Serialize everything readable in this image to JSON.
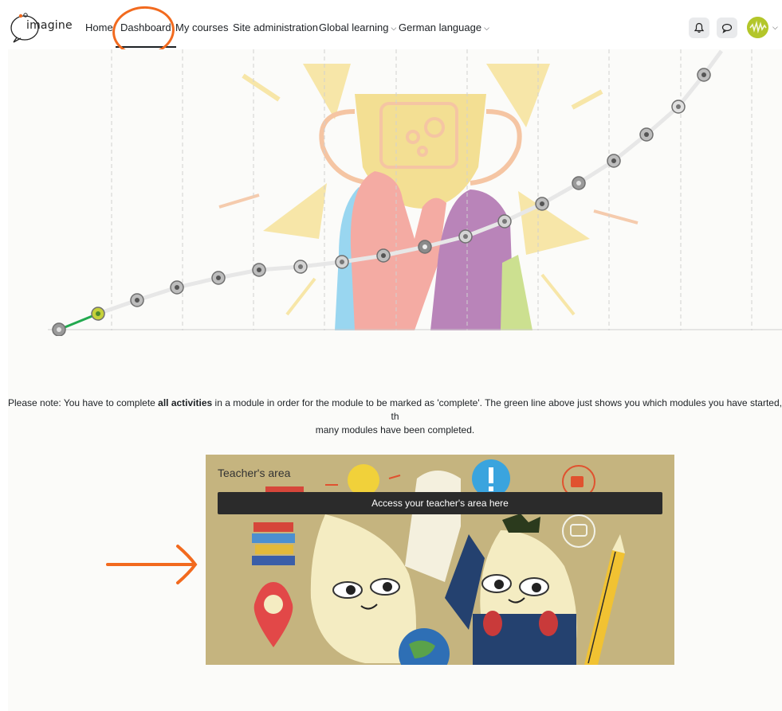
{
  "app": {
    "logo_text": "imagine"
  },
  "nav": {
    "items": [
      {
        "label": "Home"
      },
      {
        "label": "Dashboard"
      },
      {
        "label": "My courses"
      },
      {
        "label": "Site administration"
      },
      {
        "label": "Global learning"
      },
      {
        "label": "German language"
      }
    ],
    "active": "Dashboard"
  },
  "header_icons": [
    "bell-icon",
    "chat-bubble-icon",
    "user-avatar"
  ],
  "progress": {
    "modules_total": 18,
    "modules_started": 1,
    "accent_color": "#22a94f",
    "track_color": "#e6e6e6"
  },
  "note": {
    "prefix": "Please note: You have to complete ",
    "bold": "all activities",
    "suffix": " in a module in order for the module to be marked as 'complete'. The green line above just shows you which modules you have started, th",
    "line2": "many modules have been completed."
  },
  "teacher_area": {
    "title": "Teacher's area",
    "button_label": "Access your teacher's area here"
  },
  "annotation_color": "#f26a1e"
}
